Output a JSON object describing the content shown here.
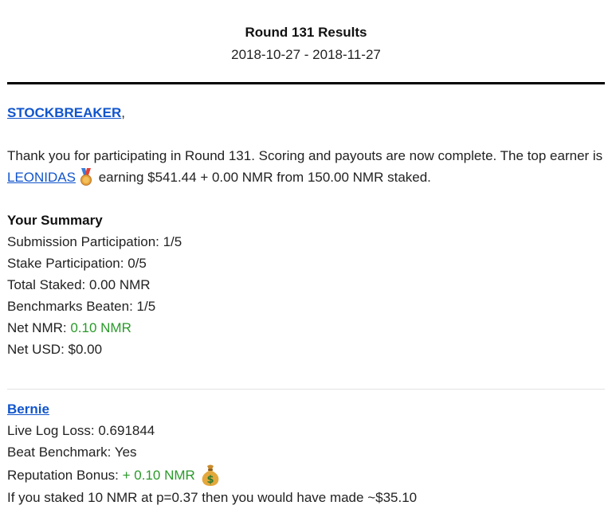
{
  "header": {
    "title": "Round 131 Results",
    "date_range": "2018-10-27 - 2018-11-27"
  },
  "greeting": {
    "username": "STOCKBREAKER",
    "suffix": ","
  },
  "intro": {
    "text_before": "Thank you for participating in Round 131. Scoring and payouts are now complete. The top earner is ",
    "top_earner": "LEONIDAS",
    "top_earner_icon": "medal-icon",
    "text_after": " earning $541.44 + 0.00 NMR from 150.00 NMR staked."
  },
  "summary": {
    "heading": "Your Summary",
    "submission_participation": "Submission Participation: 1/5",
    "stake_participation": "Stake Participation: 0/5",
    "total_staked": "Total Staked: 0.00 NMR",
    "benchmarks_beaten": "Benchmarks Beaten: 1/5",
    "net_nmr_label": "Net NMR: ",
    "net_nmr_value": "0.10 NMR",
    "net_usd": "Net USD: $0.00"
  },
  "model": {
    "name": "Bernie",
    "live_log_loss": "Live Log Loss: 0.691844",
    "beat_benchmark": "Beat Benchmark: Yes",
    "reputation_bonus_label": "Reputation Bonus: ",
    "reputation_bonus_value": "+ 0.10 NMR",
    "reputation_bonus_icon": "money-bag-icon",
    "stake_hint": "If you staked 10 NMR at p=0.37 then you would have made ~$35.10"
  },
  "colors": {
    "link": "#1155cc",
    "positive": "#2a9a2a",
    "rule": "#000000"
  }
}
